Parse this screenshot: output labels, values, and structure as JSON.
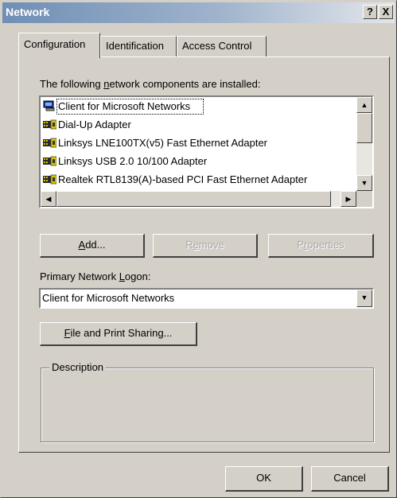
{
  "window": {
    "title": "Network",
    "help_glyph": "?",
    "close_glyph": "X"
  },
  "tabs": [
    {
      "label": "Configuration",
      "active": true
    },
    {
      "label": "Identification",
      "active": false
    },
    {
      "label": "Access Control",
      "active": false
    }
  ],
  "components": {
    "heading_before": "The following ",
    "heading_accel": "n",
    "heading_after": "etwork components are installed:",
    "items": [
      {
        "label": "Client for Microsoft Networks",
        "icon": "network-client-icon",
        "selected": true
      },
      {
        "label": "Dial-Up Adapter",
        "icon": "network-adapter-icon",
        "selected": false
      },
      {
        "label": "Linksys LNE100TX(v5) Fast Ethernet Adapter",
        "icon": "network-adapter-icon",
        "selected": false
      },
      {
        "label": "Linksys USB 2.0 10/100 Adapter",
        "icon": "network-adapter-icon",
        "selected": false
      },
      {
        "label": "Realtek RTL8139(A)-based PCI Fast Ethernet Adapter",
        "icon": "network-adapter-icon",
        "selected": false
      }
    ]
  },
  "buttons": {
    "add_accel": "A",
    "add_rest": "dd...",
    "remove_before": "R",
    "remove_accel": "e",
    "remove_after": "move",
    "properties_before": "P",
    "properties_accel": "r",
    "properties_after": "operties",
    "file_print_accel": "F",
    "file_print_rest": "ile and Print Sharing...",
    "ok": "OK",
    "cancel": "Cancel"
  },
  "logon": {
    "label_before": "Primary Network ",
    "label_accel": "L",
    "label_after": "ogon:",
    "selected": "Client for Microsoft Networks"
  },
  "description": {
    "label": "Description",
    "text": ""
  },
  "colors": {
    "face": "#d4d0c8",
    "title_start": "#6f8fb5",
    "title_end": "#e3e6ea",
    "disabled_text": "#a8a8a8"
  }
}
